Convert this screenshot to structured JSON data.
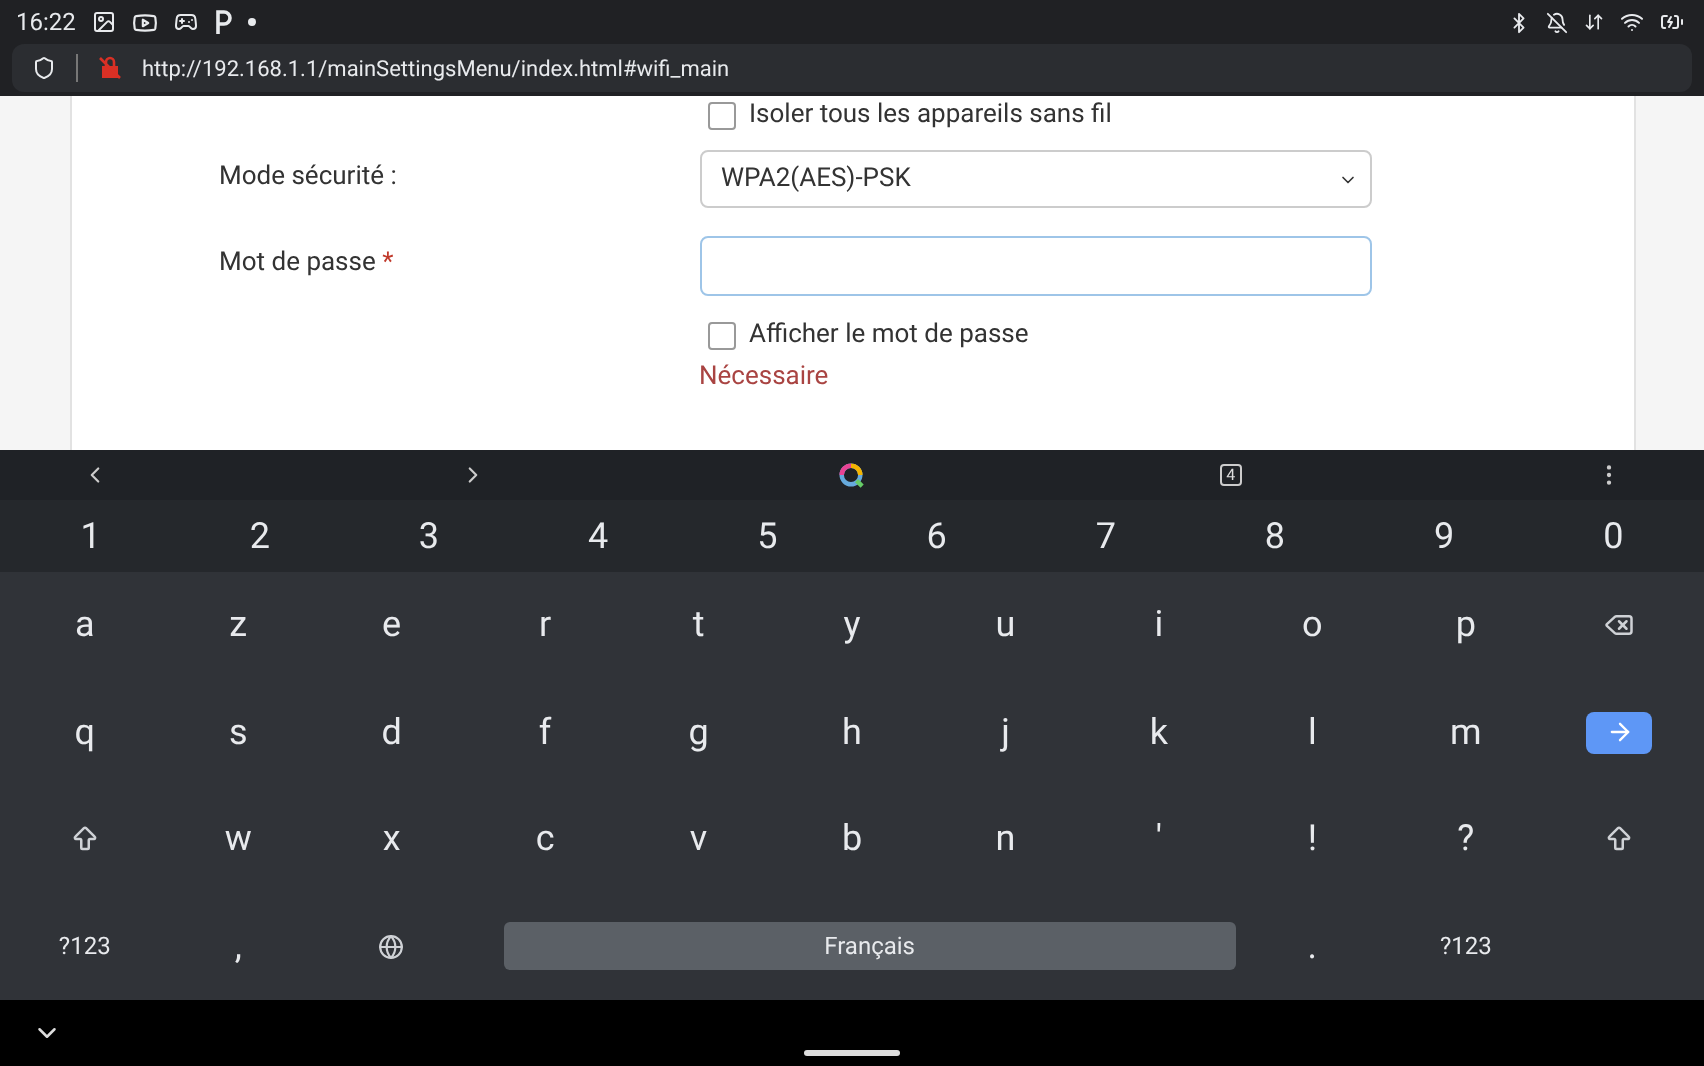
{
  "status_bar": {
    "time": "16:22"
  },
  "address_bar": {
    "url": "http://192.168.1.1/mainSettingsMenu/index.html#wifi_main"
  },
  "form": {
    "isolate_checkbox": {
      "label": "Isoler tous les appareils sans fil",
      "checked": false
    },
    "security_mode": {
      "label": "Mode sécurité :",
      "value": "WPA2(AES)-PSK"
    },
    "password": {
      "label": "Mot de passe",
      "required_mark": "*"
    },
    "show_password": {
      "label": "Afficher le mot de passe",
      "checked": false
    },
    "error": "Nécessaire"
  },
  "keyboard_toolbar": {
    "tab_count": "4"
  },
  "keyboard": {
    "number_row": [
      "1",
      "2",
      "3",
      "4",
      "5",
      "6",
      "7",
      "8",
      "9",
      "0"
    ],
    "rows": [
      [
        {
          "kind": "char",
          "label": "a"
        },
        {
          "kind": "char",
          "label": "z"
        },
        {
          "kind": "char",
          "label": "e"
        },
        {
          "kind": "char",
          "label": "r"
        },
        {
          "kind": "char",
          "label": "t"
        },
        {
          "kind": "char",
          "label": "y"
        },
        {
          "kind": "char",
          "label": "u"
        },
        {
          "kind": "char",
          "label": "i"
        },
        {
          "kind": "char",
          "label": "o"
        },
        {
          "kind": "char",
          "label": "p"
        },
        {
          "kind": "backspace"
        }
      ],
      [
        {
          "kind": "char",
          "label": "q"
        },
        {
          "kind": "char",
          "label": "s"
        },
        {
          "kind": "char",
          "label": "d"
        },
        {
          "kind": "char",
          "label": "f"
        },
        {
          "kind": "char",
          "label": "g"
        },
        {
          "kind": "char",
          "label": "h"
        },
        {
          "kind": "char",
          "label": "j"
        },
        {
          "kind": "char",
          "label": "k"
        },
        {
          "kind": "char",
          "label": "l"
        },
        {
          "kind": "char",
          "label": "m"
        },
        {
          "kind": "enter"
        }
      ],
      [
        {
          "kind": "shift"
        },
        {
          "kind": "char",
          "label": "w"
        },
        {
          "kind": "char",
          "label": "x"
        },
        {
          "kind": "char",
          "label": "c"
        },
        {
          "kind": "char",
          "label": "v"
        },
        {
          "kind": "char",
          "label": "b"
        },
        {
          "kind": "char",
          "label": "n"
        },
        {
          "kind": "char",
          "label": "'"
        },
        {
          "kind": "char",
          "label": "!"
        },
        {
          "kind": "char",
          "label": "?"
        },
        {
          "kind": "shift"
        }
      ]
    ],
    "bottom_row": [
      {
        "kind": "char",
        "label": "?123"
      },
      {
        "kind": "char",
        "label": ","
      },
      {
        "kind": "globe"
      },
      {
        "kind": "space",
        "label": "Français"
      },
      {
        "kind": "char",
        "label": "."
      },
      {
        "kind": "char",
        "label": "?123"
      }
    ]
  }
}
